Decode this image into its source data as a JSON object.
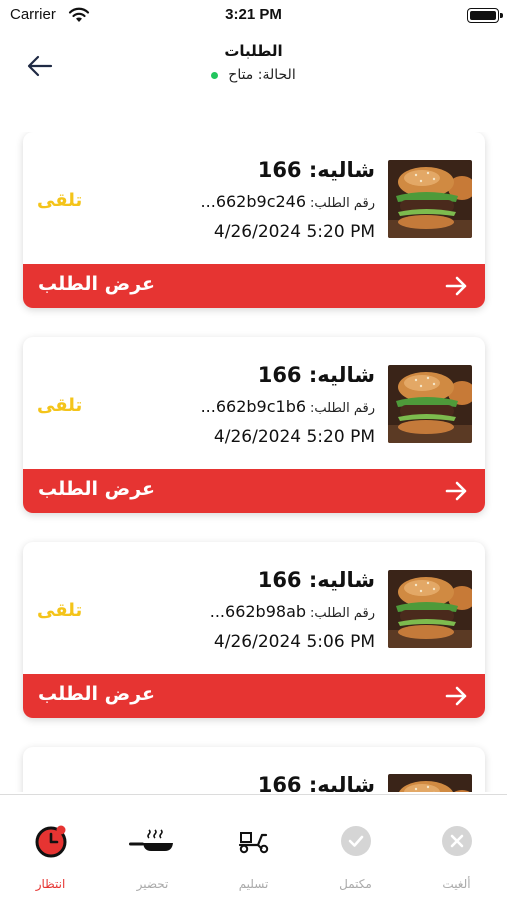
{
  "status_bar": {
    "carrier": "Carrier",
    "time": "3:21 PM"
  },
  "header": {
    "title": "الطلبات",
    "status_text": "الحالة: متاح",
    "status_color": "#22c55e"
  },
  "colors": {
    "accent": "#e63432",
    "status_pending": "#f4c41a"
  },
  "orders": [
    {
      "chalet": "شاليه: 166",
      "order_label": "رقم الطلب:",
      "order_id": "662b9c246...",
      "datetime": "4/26/2024 5:20 PM",
      "status": "تلقى",
      "button": "عرض الطلب"
    },
    {
      "chalet": "شاليه: 166",
      "order_label": "رقم الطلب:",
      "order_id": "662b9c1b6...",
      "datetime": "4/26/2024 5:20 PM",
      "status": "تلقى",
      "button": "عرض الطلب"
    },
    {
      "chalet": "شاليه: 166",
      "order_label": "رقم الطلب:",
      "order_id": "662b98ab...",
      "datetime": "4/26/2024 5:06 PM",
      "status": "تلقى",
      "button": "عرض الطلب"
    },
    {
      "chalet": "شاليه: 166"
    }
  ],
  "tabs": [
    {
      "label": "ألغيت",
      "icon": "cancelled-icon"
    },
    {
      "label": "مكتمل",
      "icon": "completed-icon"
    },
    {
      "label": "تسليم",
      "icon": "delivery-scooter-icon"
    },
    {
      "label": "تحضير",
      "icon": "frying-pan-icon"
    },
    {
      "label": "انتظار",
      "icon": "waiting-clock-icon",
      "active": true
    }
  ]
}
